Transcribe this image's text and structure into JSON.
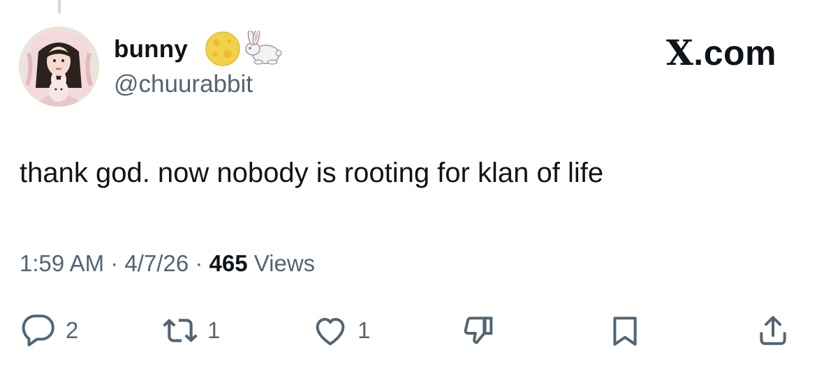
{
  "tweet": {
    "display_name": "bunny",
    "handle": "@chuurabbit",
    "brand": "X.com",
    "text": "thank god. now nobody is rooting for klan of life",
    "time": "1:59 AM",
    "separator": "·",
    "date": "4/7/26",
    "views_count": "465",
    "views_label": "Views"
  },
  "actions": {
    "replies": "2",
    "reposts": "1",
    "likes": "1"
  },
  "icons": {
    "name_emoji_1": "full-moon-face-emoji",
    "name_emoji_2": "rabbit-emoji",
    "reply": "reply-bubble-icon",
    "repost": "repost-icon",
    "like": "heart-icon",
    "dislike": "thumbs-down-icon",
    "bookmark": "bookmark-icon",
    "share": "share-icon"
  },
  "colors": {
    "text_primary": "#0f1419",
    "text_secondary": "#536471",
    "background": "#ffffff"
  }
}
